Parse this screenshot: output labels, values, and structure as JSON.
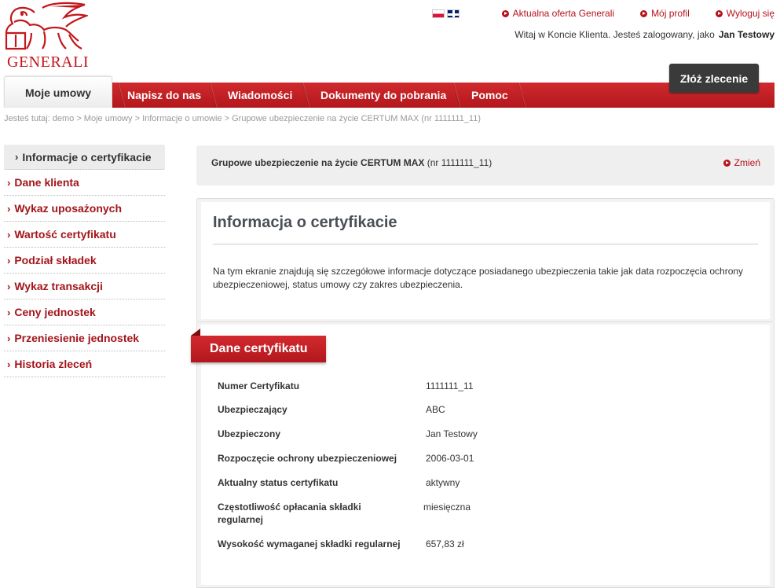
{
  "brand": {
    "name": "GENERALI",
    "color": "#c4161c"
  },
  "header": {
    "flags": [
      "pl-flag-icon",
      "en-flag-icon"
    ],
    "links": [
      {
        "label": "Aktualna oferta Generali"
      },
      {
        "label": "Mój profil"
      },
      {
        "label": "Wyloguj się"
      }
    ],
    "welcome_text": "Witaj w Koncie Klienta. Jesteś zalogowany, jako",
    "user_name": "Jan Testowy",
    "order_button": "Złóż zlecenie"
  },
  "nav": {
    "tabs": [
      {
        "label": "Moje umowy",
        "active": true
      },
      {
        "label": "Napisz do nas"
      },
      {
        "label": "Wiadomości"
      },
      {
        "label": "Dokumenty do pobrania"
      },
      {
        "label": "Pomoc"
      }
    ]
  },
  "breadcrumb": "Jesteś tutaj: demo > Moje umowy > Informacje o umowie > Grupowe ubezpieczenie na życie CERTUM MAX (nr 1111111_11)",
  "sidebar": {
    "items": [
      {
        "label": "Informacje o certyfikacie",
        "active": true
      },
      {
        "label": "Dane klienta"
      },
      {
        "label": "Wykaz uposażonych"
      },
      {
        "label": "Wartość certyfikatu"
      },
      {
        "label": "Podział składek"
      },
      {
        "label": "Wykaz transakcji"
      },
      {
        "label": "Ceny jednostek"
      },
      {
        "label": "Przeniesienie jednostek"
      },
      {
        "label": "Historia zleceń"
      }
    ]
  },
  "contract": {
    "title_bold": "Grupowe ubezpieczenie na życie CERTUM MAX",
    "title_number": "(nr 1111111_11)",
    "change_label": "Zmień"
  },
  "info": {
    "heading": "Informacja o certyfikacie",
    "text": "Na tym ekranie znajdują się szczegółowe informacje dotyczące posiadanego ubezpieczenia takie jak data rozpoczęcia ochrony ubezpieczeniowej, status umowy czy zakres ubezpieczenia."
  },
  "details": {
    "section_title": "Dane certyfikatu",
    "rows": [
      {
        "label": "Numer Certyfikatu",
        "value": "1111111_11"
      },
      {
        "label": "Ubezpieczający",
        "value": "ABC"
      },
      {
        "label": "Ubezpieczony",
        "value": "Jan Testowy"
      },
      {
        "label": "Rozpoczęcie ochrony ubezpieczeniowej",
        "value": "2006-03-01"
      },
      {
        "label": "Aktualny status certyfikatu",
        "value": "aktywny"
      },
      {
        "label": "Częstotliwość opłacania składki regularnej",
        "value": "miesięczna"
      },
      {
        "label": "Wysokość wymaganej składki regularnej",
        "value": "657,83 zł"
      }
    ]
  }
}
